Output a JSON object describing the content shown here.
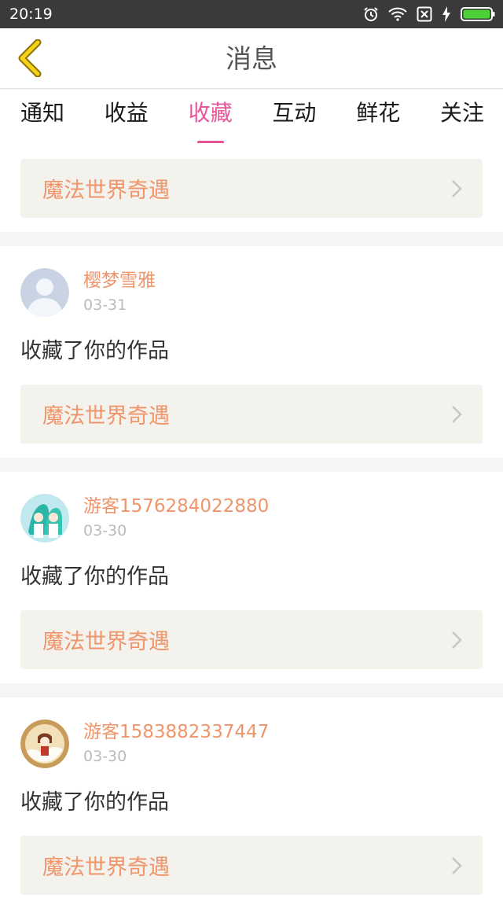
{
  "status_bar": {
    "time": "20:19",
    "icons": [
      "alarm-icon",
      "wifi-icon",
      "no-sim-icon",
      "charging-icon",
      "battery-icon"
    ]
  },
  "header": {
    "title": "消息",
    "back_icon": "chevron-left-icon"
  },
  "tabs": [
    {
      "label": "通知",
      "active": false
    },
    {
      "label": "收益",
      "active": false
    },
    {
      "label": "收藏",
      "active": true
    },
    {
      "label": "互动",
      "active": false
    },
    {
      "label": "鲜花",
      "active": false
    },
    {
      "label": "关注",
      "active": false
    }
  ],
  "top_card": {
    "work_title": "魔法世界奇遇"
  },
  "messages": [
    {
      "user": "樱梦雪雅",
      "date": "03-31",
      "action": "收藏了你的作品",
      "work_title": "魔法世界奇遇",
      "avatar": "default-avatar"
    },
    {
      "user": "游客1576284022880",
      "date": "03-30",
      "action": "收藏了你的作品",
      "work_title": "魔法世界奇遇",
      "avatar": "anime-avatar"
    },
    {
      "user": "游客1583882337447",
      "date": "03-30",
      "action": "收藏了你的作品",
      "work_title": "魔法世界奇遇",
      "avatar": "anime-avatar-2"
    }
  ],
  "colors": {
    "accent": "#e8569a",
    "name": "#f0946a",
    "card_bg": "#f3f2ec",
    "back_icon": "#f3c200"
  }
}
